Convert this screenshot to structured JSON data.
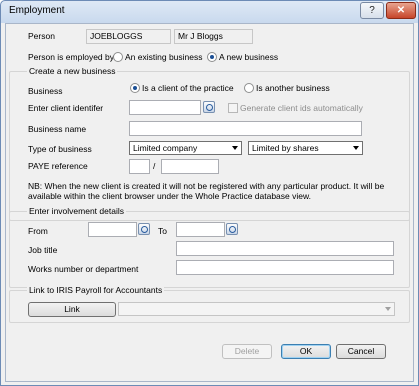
{
  "window": {
    "title": "Employment",
    "help_glyph": "?",
    "close_glyph": "✕"
  },
  "person": {
    "label": "Person",
    "code": "JOEBLOGGS",
    "name": "Mr J Bloggs"
  },
  "employed_by": {
    "label": "Person is employed by",
    "options": [
      "An existing business",
      "A new business"
    ],
    "selected": "A new business"
  },
  "new_business": {
    "group_title": "Create a new business",
    "business_label": "Business",
    "business_options": [
      "Is a client of the practice",
      "Is another business"
    ],
    "business_selected": "Is a client of the practice",
    "client_id_label": "Enter client identifer",
    "client_id_value": "",
    "generate_ids_label": "Generate client ids automatically",
    "business_name_label": "Business name",
    "business_name_value": "",
    "type_label": "Type of business",
    "type_value": "Limited company",
    "type_sub_value": "Limited by shares",
    "paye_label": "PAYE reference",
    "paye_sep": "/",
    "note": "NB: When the new client is created it will not be registered with any particular product. It will be available within the client browser under the Whole Practice database view."
  },
  "involvement": {
    "group_title": "Enter involvement details",
    "from_label": "From",
    "to_label": "To",
    "job_title_label": "Job title",
    "works_number_label": "Works number or department"
  },
  "payroll": {
    "group_title": "Link to IRIS Payroll for Accountants",
    "link_label": "Link",
    "link_value": ""
  },
  "buttons": {
    "delete": "Delete",
    "ok": "OK",
    "cancel": "Cancel"
  }
}
